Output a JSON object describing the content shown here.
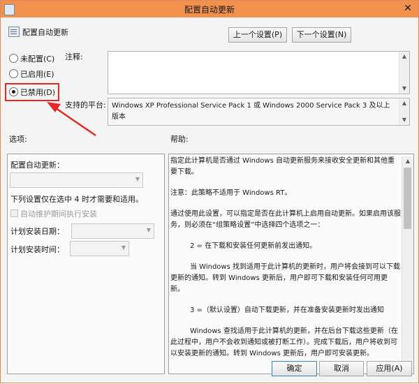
{
  "window": {
    "title": "配置自动更新",
    "close_glyph": "✕"
  },
  "header": {
    "policy_name": "配置自动更新"
  },
  "nav": {
    "prev_label": "上一个设置(P)",
    "next_label": "下一个设置(N)"
  },
  "state": {
    "options": [
      {
        "label": "未配置(C)",
        "selected": false
      },
      {
        "label": "已启用(E)",
        "selected": false
      },
      {
        "label": "已禁用(D)",
        "selected": true
      }
    ]
  },
  "comment": {
    "label": "注释:",
    "value": ""
  },
  "platform": {
    "label": "支持的平台:",
    "value": "Windows XP Professional Service Pack 1 或 Windows 2000 Service Pack 3 及以上版本"
  },
  "options_pane": {
    "label": "选项:",
    "configure_label": "配置自动更新：",
    "note": "下列设置仅在选中 4 时才需要和适用。",
    "maintenance_checkbox": "自动维护期间执行安装",
    "schedule_day_label": "计划安装日期：",
    "schedule_time_label": "计划安装时间："
  },
  "help_pane": {
    "label": "帮助:",
    "paragraphs": [
      "指定此计算机是否通过 Windows 自动更新服务来接收安全更新和其他重要下载。",
      "注意：此策略不适用于 Windows RT。",
      "通过使用此设置，可以指定是否在此计算机上启用自动更新。如果启用该服务，则必须在“组策略设置”中选择四个选项之一：",
      "2 = 在下载和安装任何更新前发出通知。",
      "当 Windows 找到适用于此计算机的更新时，用户将会接到可以下载更新的通知。转到 Windows 更新后，用户即可下载和安装任何可用更新。",
      "3 =（默认设置）自动下载更新，并在准备安装更新时发出通知",
      "Windows 查找适用于此计算机的更新，并在后台下载这些更新（在此过程中，用户不会收到通知或被打断工作）。完成下载后，用户将收到可以安装更新的通知。转到 Windows 更新后，用户即可安装更新。"
    ]
  },
  "footer": {
    "ok_label": "确定",
    "cancel_label": "取消",
    "apply_label": "应用(A)"
  },
  "annotation": {
    "highlight_color": "#e32a24",
    "arrow_color": "#e32a24"
  }
}
